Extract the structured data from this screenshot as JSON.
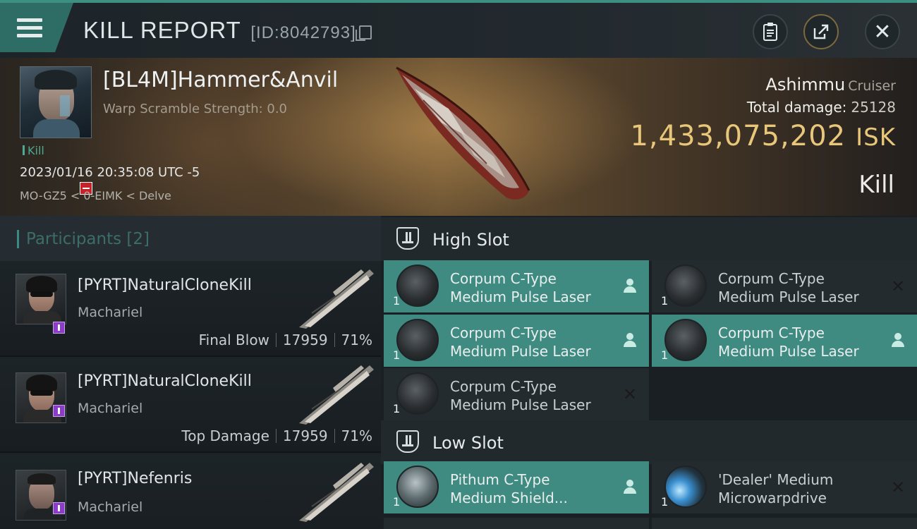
{
  "header": {
    "title": "KILL REPORT",
    "report_id": "[ID:8042793]",
    "icons": [
      "menu-icon",
      "copy-icon",
      "clipboard-icon",
      "share-icon",
      "close-icon"
    ]
  },
  "victim": {
    "name": "[BL4M]Hammer&Anvil",
    "warp_scramble": "Warp Scramble Strength: 0.0",
    "status_tag": "Kill",
    "timestamp": "2023/01/16 20:35:08 UTC -5",
    "location": "MO-GZ5 < 0-EIMK < Delve",
    "ship_name": "Ashimmu",
    "ship_class": "Cruiser",
    "total_damage_label": "Total damage:",
    "total_damage": "25128",
    "isk_value": "1,433,075,202",
    "isk_unit": "ISK",
    "result": "Kill"
  },
  "participants": {
    "title": "Participants",
    "count": "[2]",
    "items": [
      {
        "name": "[PYRT]NaturalCloneKill",
        "ship": "Machariel",
        "role": "Final Blow",
        "damage": "17959",
        "percent": "71%"
      },
      {
        "name": "[PYRT]NaturalCloneKill",
        "ship": "Machariel",
        "role": "Top Damage",
        "damage": "17959",
        "percent": "71%"
      },
      {
        "name": "[PYRT]Nefenris",
        "ship": "Machariel",
        "role": "",
        "damage": "",
        "percent": ""
      }
    ]
  },
  "slots": {
    "high": {
      "title": "High Slot",
      "modules": [
        {
          "line1": "Corpum C-Type",
          "line2": "Medium Pulse Laser",
          "qty": "1",
          "state": "dropped"
        },
        {
          "line1": "Corpum C-Type",
          "line2": "Medium Pulse Laser",
          "qty": "1",
          "state": "destroyed"
        },
        {
          "line1": "Corpum C-Type",
          "line2": "Medium Pulse Laser",
          "qty": "1",
          "state": "dropped"
        },
        {
          "line1": "Corpum C-Type",
          "line2": "Medium Pulse Laser",
          "qty": "1",
          "state": "dropped"
        },
        {
          "line1": "Corpum C-Type",
          "line2": "Medium Pulse Laser",
          "qty": "1",
          "state": "destroyed"
        }
      ]
    },
    "low": {
      "title": "Low Slot",
      "modules": [
        {
          "line1": "Pithum C-Type",
          "line2": "Medium Shield...",
          "qty": "1",
          "state": "dropped"
        },
        {
          "line1": "'Dealer' Medium",
          "line2": "Microwarpdrive",
          "qty": "1",
          "state": "destroyed"
        }
      ]
    }
  },
  "colors": {
    "accent": "#3f8a81",
    "isk": "#e8c77a",
    "header_stripe": "#3d8f82",
    "badge_red": "#c5222a",
    "badge_purple": "#8b3cc8"
  }
}
